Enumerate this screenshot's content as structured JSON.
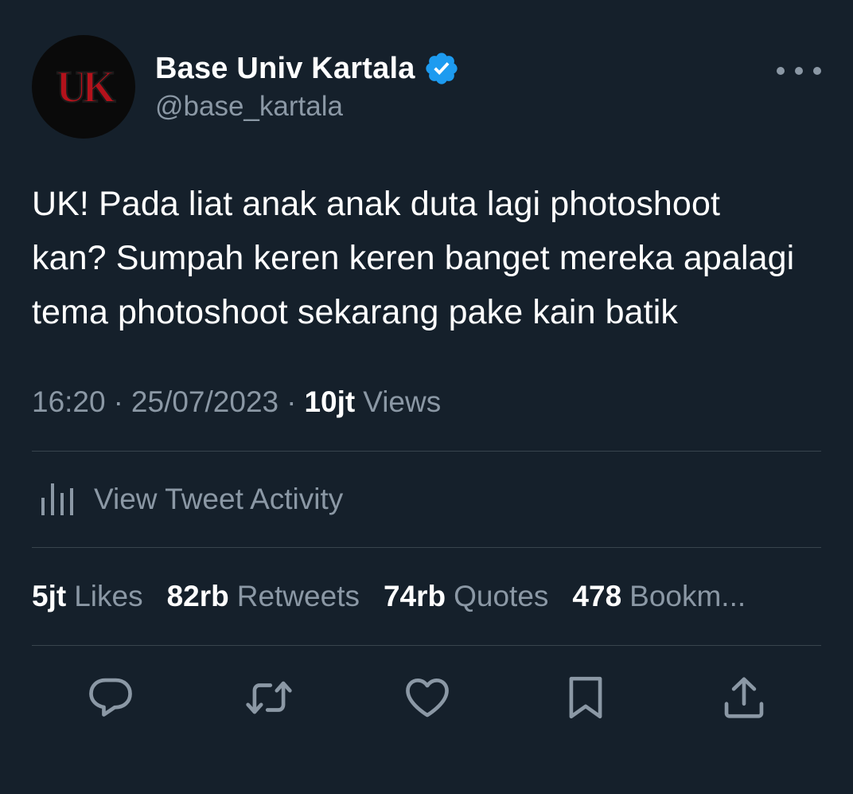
{
  "author": {
    "display_name": "Base Univ Kartala",
    "handle": "@base_kartala",
    "avatar_text": "UK",
    "verified": true,
    "verified_color": "#1d9bf0"
  },
  "tweet": {
    "text": "UK! Pada liat anak anak duta lagi photoshoot kan? Sumpah keren keren banget mereka apalagi tema photoshoot sekarang pake kain batik",
    "time": "16:20",
    "separator": "·",
    "date": "25/07/2023",
    "views_count": "10jt",
    "views_label": "Views"
  },
  "activity": {
    "label": "View Tweet Activity",
    "icon": "analytics-icon"
  },
  "stats": [
    {
      "count": "5jt",
      "label": "Likes"
    },
    {
      "count": "82rb",
      "label": "Retweets"
    },
    {
      "count": "74rb",
      "label": "Quotes"
    },
    {
      "count": "478",
      "label": "Bookm..."
    }
  ],
  "actions": [
    {
      "name": "reply",
      "icon": "reply-icon"
    },
    {
      "name": "retweet",
      "icon": "retweet-icon"
    },
    {
      "name": "like",
      "icon": "heart-icon"
    },
    {
      "name": "bookmark",
      "icon": "bookmark-icon"
    },
    {
      "name": "share",
      "icon": "share-icon"
    }
  ],
  "colors": {
    "background": "#15202b",
    "primary_text": "#ffffff",
    "secondary_text": "#8b98a5",
    "divider": "#38444d",
    "avatar_logo": "#b3121b"
  }
}
